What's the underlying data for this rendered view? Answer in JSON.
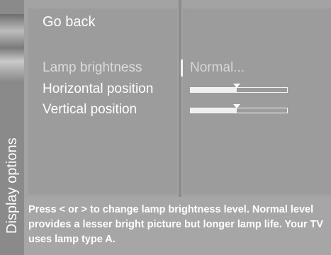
{
  "sidebar": {
    "title": "Display options"
  },
  "menu": {
    "go_back": "Go back",
    "items": [
      {
        "label": "Lamp brightness",
        "value": "Normal..."
      },
      {
        "label": "Horizontal position",
        "level": 0.48
      },
      {
        "label": "Vertical position",
        "level": 0.48
      }
    ]
  },
  "help": {
    "text": "Press < or > to change lamp brightness level. Normal level provides a lesser bright picture but longer lamp life. Your TV uses lamp type A."
  }
}
